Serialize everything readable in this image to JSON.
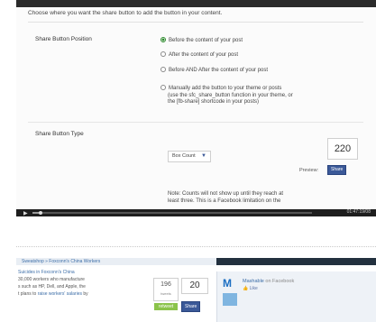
{
  "settings": {
    "intro": "Choose where you want the share button to add the button in your content.",
    "position_label": "Share Button Position",
    "options": [
      {
        "label": "Before the content of your post",
        "selected": true
      },
      {
        "label": "After the content of your post",
        "selected": false
      },
      {
        "label": "Before AND After the content of your post",
        "selected": false
      },
      {
        "label": "Manually add the button to your theme or posts",
        "sub1": "(use the sfc_share_button function in your theme, or",
        "sub2": "the [fb-share] shortcode in your posts)",
        "selected": false
      }
    ],
    "type_label": "Share Button Type",
    "type_value": "Box Count",
    "count": "220",
    "preview_label": "Preview:",
    "share_label": "Share",
    "note_line1": "Note: Counts will not show up until they reach at",
    "note_line2": "least three. This is a Facebook limitation on the"
  },
  "player": {
    "progress": 0.03,
    "time": "01:47:19/08"
  },
  "mashable": {
    "top_link": "Sweatshop » Foxconn's China Workers",
    "article_lines": [
      {
        "pre": "",
        "link": "Suicides in Foxconn's China",
        "post": ""
      },
      {
        "pre": "30,000 workers who manufacture",
        "link": "",
        "post": ""
      },
      {
        "pre": "s such as HP, Dell, and Apple, the",
        "link": "",
        "post": ""
      },
      {
        "pre": "t plans to ",
        "link": "raise workers' salaries",
        "post": " by"
      }
    ],
    "count_a": "196",
    "count_a_label": "tweets",
    "count_b": "20",
    "retweet_label": "retweet",
    "share_label": "Share",
    "widget_name": "Mashable",
    "widget_suffix": "on Facebook",
    "widget_like": "Like"
  },
  "colors": {
    "facebook": "#3b5998",
    "accent_green": "#2e8b2e"
  }
}
